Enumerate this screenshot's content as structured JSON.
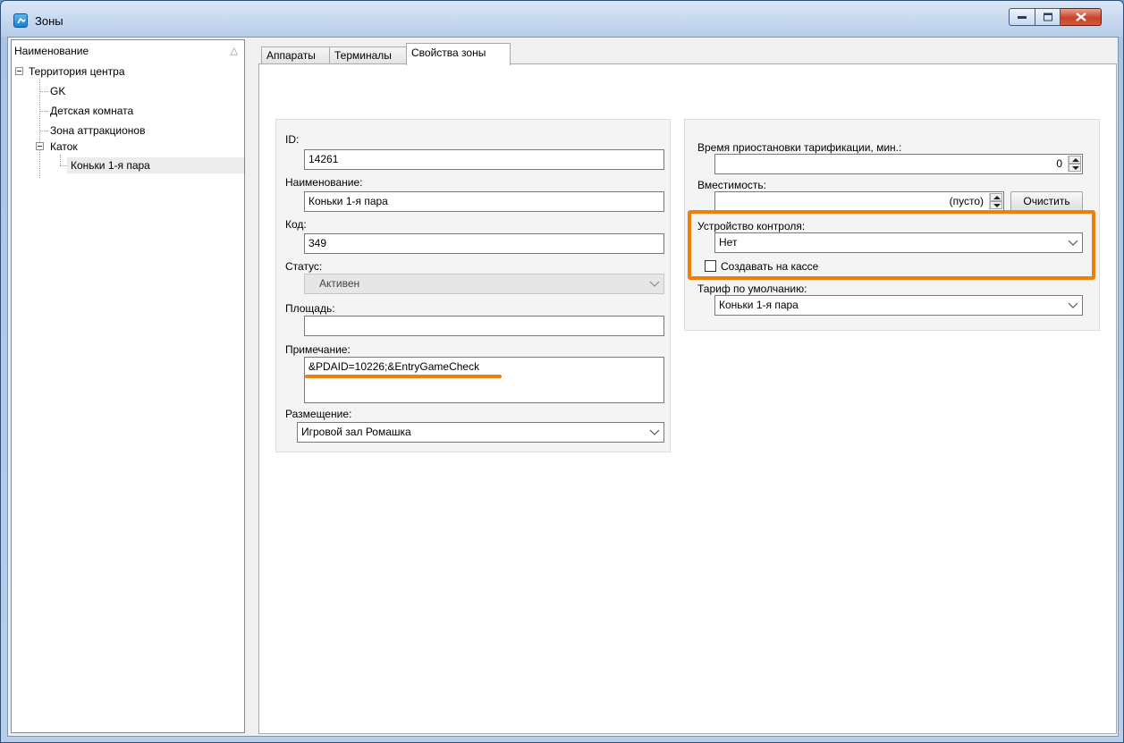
{
  "window": {
    "title": "Зоны",
    "icons": {
      "app": "app-icon",
      "minimize": "minimize-icon",
      "maximize": "maximize-icon",
      "close": "close-icon"
    }
  },
  "tree": {
    "header": "Наименование",
    "sort_indicator": "△",
    "nodes": [
      {
        "label": "Территория центра"
      },
      {
        "label": "GK"
      },
      {
        "label": "Детская комната"
      },
      {
        "label": "Зона аттракционов"
      },
      {
        "label": "Каток"
      },
      {
        "label": "Коньки 1-я пара"
      }
    ]
  },
  "tabs": [
    {
      "label": "Аппараты"
    },
    {
      "label": "Терминалы"
    },
    {
      "label": "Свойства зоны"
    }
  ],
  "form": {
    "id_label": "ID:",
    "id_value": "14261",
    "name_label": "Наименование:",
    "name_value": "Коньки 1-я пара",
    "code_label": "Код:",
    "code_value": "349",
    "status_label": "Статус:",
    "status_value": "Активен",
    "area_label": "Площадь:",
    "area_value": "",
    "note_label": "Примечание:",
    "note_value": "&PDAID=10226;&EntryGameCheck",
    "placement_label": "Размещение:",
    "placement_value": "Игровой зал Ромашка"
  },
  "right": {
    "pause_label": "Время приостановки тарификации, мин.:",
    "pause_value": "0",
    "capacity_label": "Вместимость:",
    "capacity_value": "(пусто)",
    "clear_button": "Очистить",
    "control_label": "Устройство контроля:",
    "control_value": "Нет",
    "create_checkbox_label": "Создавать на кассе",
    "create_checked": false,
    "tariff_label": "Тариф по умолчанию:",
    "tariff_value": "Коньки 1-я пара"
  },
  "colors": {
    "annotation": "#f07e0a"
  }
}
